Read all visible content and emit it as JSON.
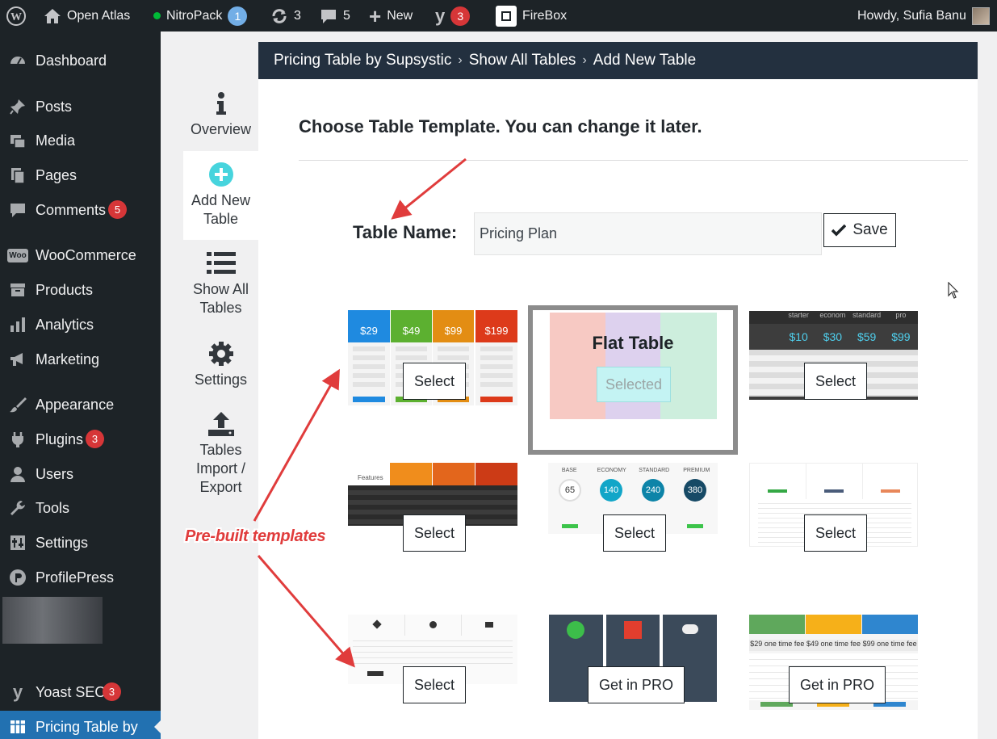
{
  "adminbar": {
    "site_name": "Open Atlas",
    "nitropack_label": "NitroPack",
    "nitropack_count": "1",
    "updates_count": "3",
    "comments_count": "5",
    "new_label": "New",
    "yoast_count": "3",
    "firebox_label": "FireBox",
    "howdy": "Howdy, Sufia Banu"
  },
  "sidebar": {
    "items": [
      {
        "label": "Dashboard"
      },
      {
        "label": "Posts"
      },
      {
        "label": "Media"
      },
      {
        "label": "Pages"
      },
      {
        "label": "Comments",
        "count": "5"
      },
      {
        "label": "WooCommerce"
      },
      {
        "label": "Products"
      },
      {
        "label": "Analytics"
      },
      {
        "label": "Marketing"
      },
      {
        "label": "Appearance"
      },
      {
        "label": "Plugins",
        "count": "3"
      },
      {
        "label": "Users"
      },
      {
        "label": "Tools"
      },
      {
        "label": "Settings"
      },
      {
        "label": "ProfilePress"
      },
      {
        "label": "Yoast SEO",
        "count": "3"
      },
      {
        "label": "Pricing Table by"
      }
    ]
  },
  "subnav": {
    "overview": "Overview",
    "add_new_1": "Add New",
    "add_new_2": "Table",
    "show_all_1": "Show All",
    "show_all_2": "Tables",
    "settings": "Settings",
    "import_1": "Tables",
    "import_2": "Import /",
    "import_3": "Export"
  },
  "breadcrumb": {
    "root": "Pricing Table by Supsystic",
    "mid": "Show All Tables",
    "current": "Add New Table"
  },
  "main": {
    "heading": "Choose Table Template. You can change it later.",
    "table_name_label": "Table Name:",
    "table_name_value": "Pricing Plan",
    "save_label": "Save"
  },
  "templates": {
    "select_label": "Select",
    "selected_label": "Selected",
    "featured_title": "Flat Table",
    "pro_label": "Get in PRO",
    "t1_prices": [
      "$29",
      "$49",
      "$99",
      "$199"
    ],
    "t3_prices": [
      "$10",
      "$30",
      "$59",
      "$99"
    ],
    "t3_headers": [
      "starter",
      "econom",
      "standard",
      "pro"
    ],
    "t5_headers": [
      "BASE",
      "ECONOMY",
      "STANDARD",
      "PREMIUM"
    ],
    "t5_values": [
      "65",
      "140",
      "240",
      "380"
    ],
    "t4_features": "Features",
    "t9_fees": [
      "$29 one time fee",
      "$49 one time fee",
      "$99 one time fee"
    ]
  },
  "annotation": {
    "text": "Pre-built templates"
  },
  "colors": {
    "adminbar_bg": "#1d2327",
    "sidebar_current": "#2271b1",
    "breadcrumb_bg": "#23303f",
    "annotation_red": "#e03c3c",
    "badge_red": "#d63638"
  }
}
